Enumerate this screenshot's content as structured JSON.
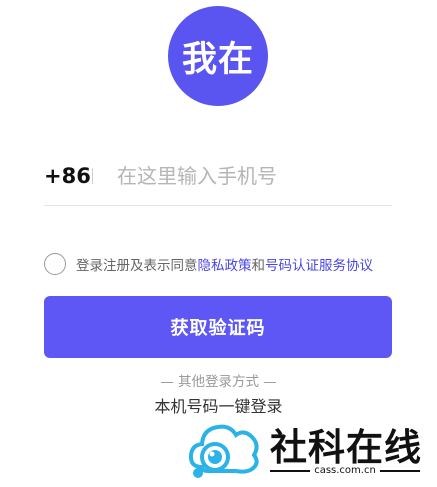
{
  "logo": {
    "text": "我在",
    "color": "#5a54f0"
  },
  "phone": {
    "country_code": "+86",
    "value": "",
    "placeholder": "在这里输入手机号"
  },
  "agreement": {
    "checked": false,
    "prefix": "登录注册及表示同意",
    "privacy_link": "隐私政策",
    "conj": "和",
    "service_link": "号码认证服务协议"
  },
  "primary_button": {
    "label": "获取验证码",
    "color": "#5f57f5"
  },
  "other_login": {
    "title": "— 其他登录方式 —",
    "onekey_label": "本机号码一键登录"
  },
  "watermark": {
    "text": "社科在线",
    "sub": "cass.com.cn"
  }
}
